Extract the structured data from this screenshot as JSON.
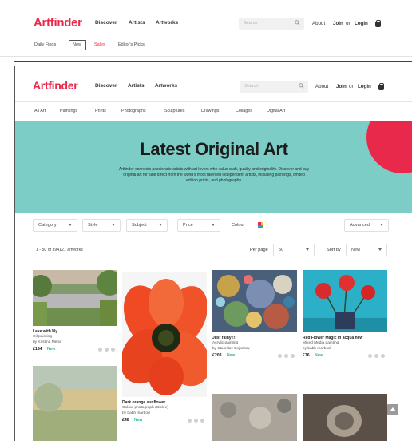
{
  "outer": {
    "logo": "Artfinder",
    "nav": [
      "Discover",
      "Artists",
      "Artworks"
    ],
    "search_placeholder": "Search",
    "about": "About",
    "join": "Join",
    "or": "or",
    "login": "Login",
    "subnav": [
      "Daily Finds",
      "New",
      "Sales",
      "Editor's Picks"
    ]
  },
  "frame": {
    "logo": "Artfinder",
    "nav": [
      "Discover",
      "Artists",
      "Artworks"
    ],
    "search_placeholder": "Search",
    "about": "About",
    "join": "Join",
    "or": "or",
    "login": "Login",
    "categories": [
      "All Art",
      "Paintings",
      "Prints",
      "Photographs",
      "Sculptures",
      "Drawings",
      "Collages",
      "Digital Art"
    ],
    "hero": {
      "title": "Latest Original Art",
      "text": "Artfinder connects passionate artists with art lovers who value craft, quality and originality. Discover and buy original art for sale direct from the world's most talented independent artists, including paintings, limited edition prints, and photography."
    },
    "filters": {
      "category": "Category",
      "style": "Style",
      "subject": "Subject",
      "price": "Price",
      "colour": "Colour",
      "advanced": "Advanced"
    },
    "results": {
      "count": "1 - 50 of 394121 artworks",
      "per_page_label": "Per page",
      "per_page_value": "50",
      "sort_label": "Sort by",
      "sort_value": "New"
    },
    "artworks": [
      {
        "title": "Lake with lily",
        "type": "Oil painting",
        "artist": "by Kristina Mena",
        "price": "£184",
        "badge": "New"
      },
      {
        "title": "Dark orange sunflower",
        "type": "Colour photograph (Giclee)",
        "artist": "by babh marbod",
        "price": "£48",
        "badge": "New"
      },
      {
        "title": "Just rainy !!!",
        "type": "Acrylic painting",
        "artist": "by Stanislav Bojankov",
        "price": "£203",
        "badge": "New"
      },
      {
        "title": "Red Flower Magic in acqua new",
        "type": "Mixed Media painting",
        "artist": "by babh marbod",
        "price": "£76",
        "badge": "New"
      }
    ]
  },
  "colors": {
    "brand": "#e8294b",
    "hero_bg": "#7dcdc7",
    "new_badge": "#2fb39a"
  }
}
